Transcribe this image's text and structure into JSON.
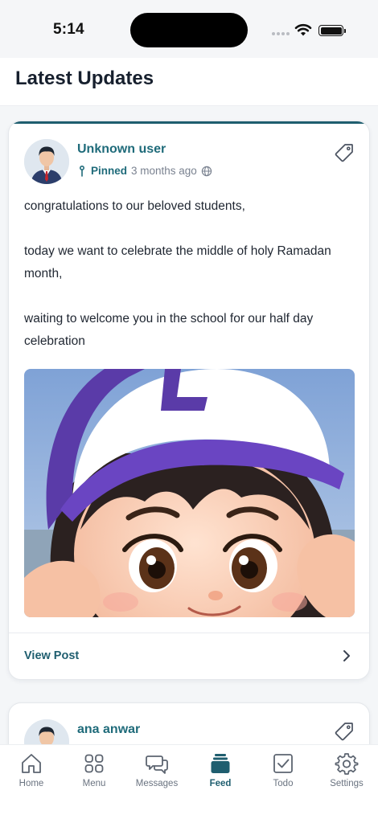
{
  "status_bar": {
    "time": "5:14"
  },
  "header": {
    "title": "Latest Updates"
  },
  "posts": [
    {
      "author": "Unknown user",
      "pinned_label": "Pinned",
      "time_ago": "3 months ago",
      "body": [
        "congratulations to our beloved students,",
        "today we want to celebrate the middle of holy Ramadan month,",
        "waiting to welcome you in the school for our half day celebration"
      ],
      "image": "cartoon-girl-purple-cap",
      "view_label": "View Post"
    },
    {
      "author": "ana anwar"
    }
  ],
  "tabs": [
    {
      "label": "Home",
      "icon": "home-icon"
    },
    {
      "label": "Menu",
      "icon": "grid-icon"
    },
    {
      "label": "Messages",
      "icon": "chat-icon"
    },
    {
      "label": "Feed",
      "icon": "feed-icon",
      "active": true
    },
    {
      "label": "Todo",
      "icon": "checkbox-icon"
    },
    {
      "label": "Settings",
      "icon": "gear-icon"
    }
  ],
  "colors": {
    "accent": "#1f5e6f",
    "author": "#1f6b7a",
    "background": "#f4f6f8"
  }
}
